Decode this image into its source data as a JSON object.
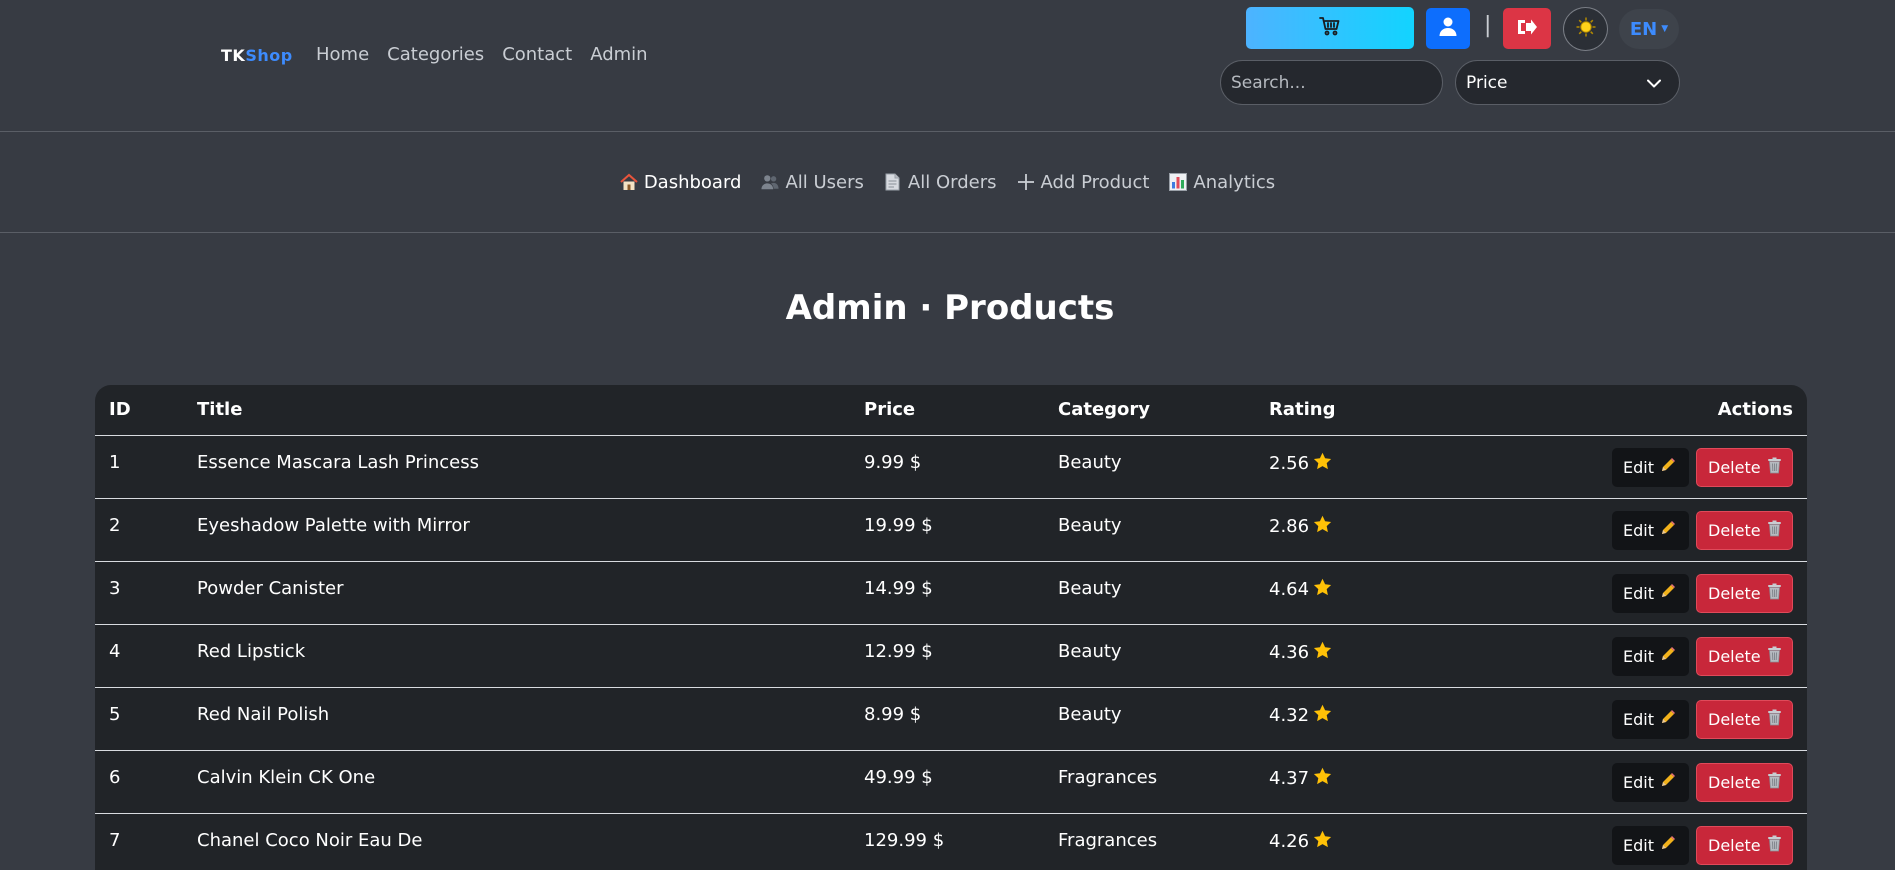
{
  "header": {
    "brand_tk": "TK",
    "brand_shop": "Shop",
    "nav": [
      {
        "label": "Home"
      },
      {
        "label": "Categories"
      },
      {
        "label": "Contact"
      },
      {
        "label": "Admin"
      }
    ],
    "separator": "|",
    "language": "EN",
    "search_placeholder": "Search...",
    "sort_selected": "Price",
    "icons": {
      "cart": "cart-icon",
      "user": "user-icon",
      "logout": "logout-icon",
      "theme": "sun-icon",
      "lang_caret": "caret-down-icon",
      "select_chevron": "chevron-down-icon"
    },
    "colors": {
      "brand_accent": "#3d8bfd",
      "cart_gradient_start": "#4db3ff",
      "cart_gradient_end": "#12d4ff",
      "user_button": "#0d6efd",
      "logout_button": "#dc3545"
    }
  },
  "admin_nav": [
    {
      "label": "Dashboard",
      "icon": "house-icon",
      "active": true
    },
    {
      "label": "All Users",
      "icon": "users-icon",
      "active": false
    },
    {
      "label": "All Orders",
      "icon": "document-icon",
      "active": false
    },
    {
      "label": "Add Product",
      "icon": "plus-icon",
      "active": false
    },
    {
      "label": "Analytics",
      "icon": "bar-chart-icon",
      "active": false
    }
  ],
  "page_title": "Admin · Products",
  "table": {
    "columns": [
      "ID",
      "Title",
      "Price",
      "Category",
      "Rating",
      "Actions"
    ],
    "rows": [
      {
        "id": "1",
        "title": "Essence Mascara Lash Princess",
        "price": "9.99 $",
        "category": "Beauty",
        "rating": "2.56"
      },
      {
        "id": "2",
        "title": "Eyeshadow Palette with Mirror",
        "price": "19.99 $",
        "category": "Beauty",
        "rating": "2.86"
      },
      {
        "id": "3",
        "title": "Powder Canister",
        "price": "14.99 $",
        "category": "Beauty",
        "rating": "4.64"
      },
      {
        "id": "4",
        "title": "Red Lipstick",
        "price": "12.99 $",
        "category": "Beauty",
        "rating": "4.36"
      },
      {
        "id": "5",
        "title": "Red Nail Polish",
        "price": "8.99 $",
        "category": "Beauty",
        "rating": "4.32"
      },
      {
        "id": "6",
        "title": "Calvin Klein CK One",
        "price": "49.99 $",
        "category": "Fragrances",
        "rating": "4.37"
      },
      {
        "id": "7",
        "title": "Chanel Coco Noir Eau De",
        "price": "129.99 $",
        "category": "Fragrances",
        "rating": "4.26"
      }
    ],
    "edit_label": "Edit",
    "delete_label": "Delete",
    "icons": {
      "rating": "star-icon",
      "edit": "pencil-icon",
      "delete": "trash-icon"
    },
    "colors": {
      "star": "#ffc107",
      "delete_button": "#c8273a"
    }
  }
}
